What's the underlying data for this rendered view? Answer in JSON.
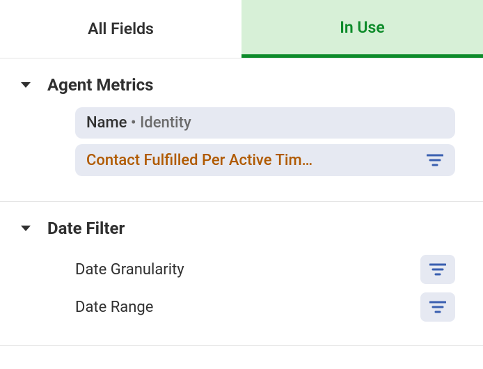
{
  "tabs": {
    "all_fields": "All Fields",
    "in_use": "In Use",
    "active": "in_use"
  },
  "sections": {
    "agent_metrics": {
      "title": "Agent Metrics",
      "items": [
        {
          "label_main": "Name",
          "label_sub": "Identity",
          "highlighted": false,
          "has_filter_icon": false
        },
        {
          "label_main": "Contact Fulfilled Per Active Tim…",
          "label_sub": "",
          "highlighted": true,
          "has_filter_icon": true
        }
      ]
    },
    "date_filter": {
      "title": "Date Filter",
      "items": [
        {
          "label": "Date Granularity",
          "has_filter_icon": true
        },
        {
          "label": "Date Range",
          "has_filter_icon": true
        }
      ]
    }
  },
  "colors": {
    "accent_green": "#0d8b2a",
    "pill_bg": "#e6e9f2",
    "highlight_text": "#b05a00",
    "filter_icon": "#3a5fb0"
  }
}
